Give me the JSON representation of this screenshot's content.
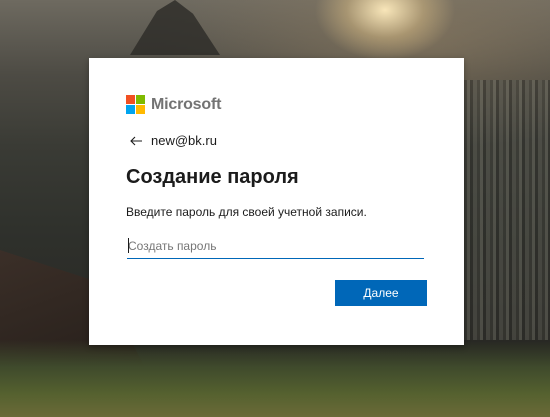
{
  "brand": {
    "name": "Microsoft",
    "logo_colors": [
      "#f25022",
      "#7fba00",
      "#00a4ef",
      "#ffb900"
    ],
    "accent": "#0067b8"
  },
  "identity": {
    "back_icon": "arrow-left-icon",
    "email": "new@bk.ru"
  },
  "page": {
    "title": "Создание пароля",
    "description": "Введите пароль для своей учетной записи."
  },
  "password": {
    "placeholder": "Создать пароль",
    "value": ""
  },
  "actions": {
    "next_label": "Далее"
  }
}
